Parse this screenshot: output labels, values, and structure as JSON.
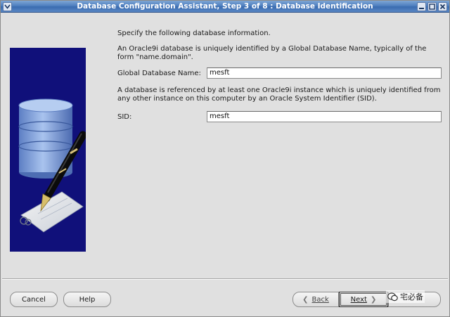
{
  "window": {
    "title": "Database Configuration Assistant, Step 3 of 8 : Database Identification"
  },
  "content": {
    "intro": "Specify the following database information.",
    "gdn_desc_line1": "An Oracle9i database is uniquely identified by a Global Database Name, typically of the",
    "gdn_desc_line2": "form \"name.domain\".",
    "gdn_label": "Global Database Name:",
    "gdn_value": "mesft",
    "sid_desc_line1": "A database is referenced by at least one Oracle9i instance which is uniquely identified from",
    "sid_desc_line2": "any other instance on this computer by an Oracle System Identifier (SID).",
    "sid_label": "SID:",
    "sid_value": "mesft"
  },
  "buttons": {
    "cancel": "Cancel",
    "help": "Help",
    "back": "Back",
    "next": "Next",
    "finish": ""
  },
  "watermark": {
    "text": "宅必备"
  },
  "icons": {
    "window_menu": "chevron-down-icon",
    "minimize": "minimize-icon",
    "maximize": "maximize-icon",
    "close": "close-icon",
    "back_arrow": "chevron-left-icon",
    "next_arrow": "chevron-right-icon"
  },
  "colors": {
    "titlebar": "#4f7fc0",
    "side_panel": "#10107a",
    "database_cylinder": "#7fa3d9"
  }
}
